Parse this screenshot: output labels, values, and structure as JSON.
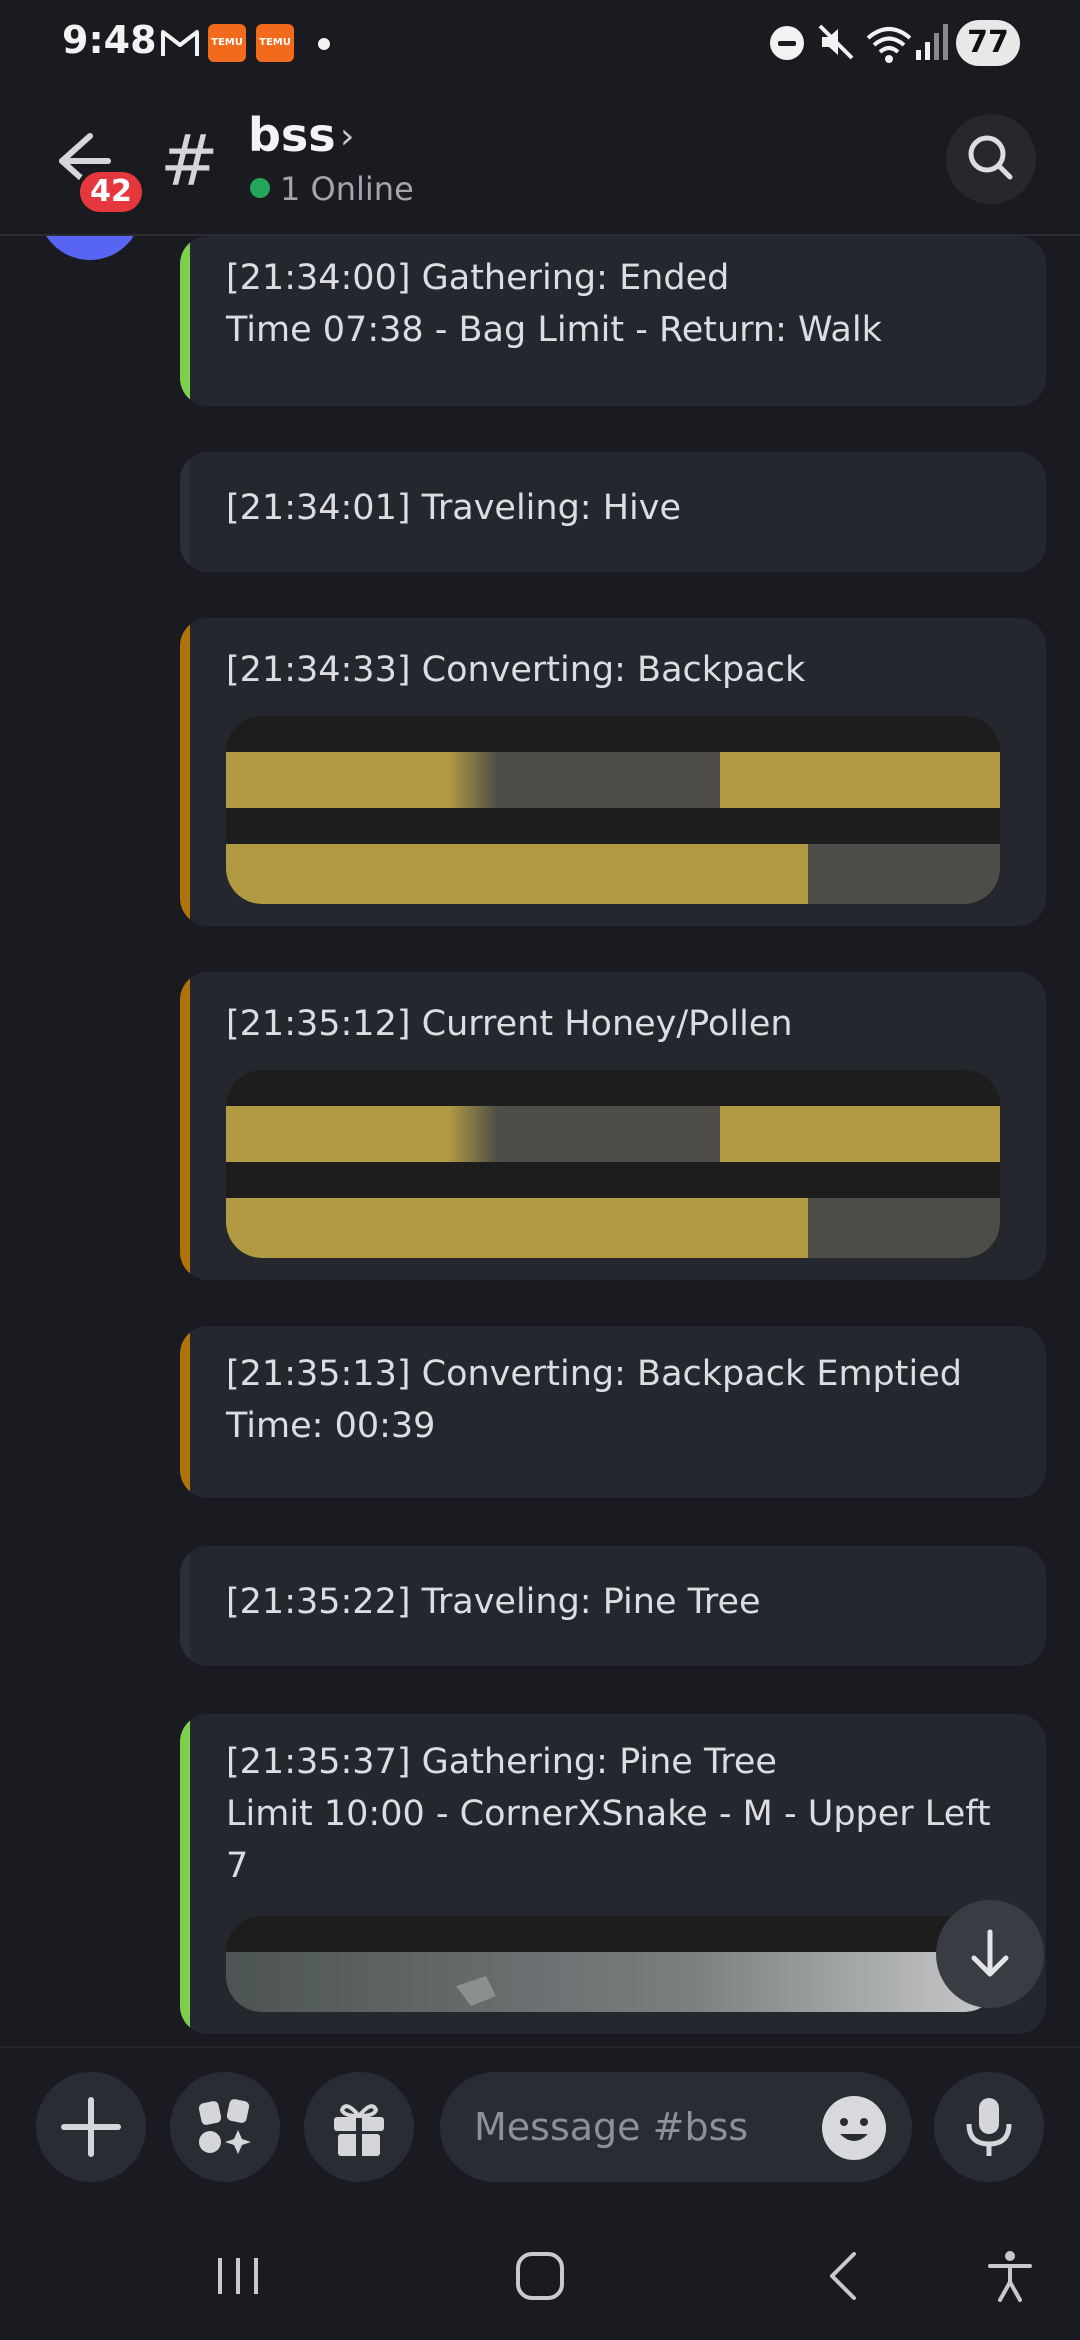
{
  "status_bar": {
    "time": "9:48",
    "temu_label": "TEMU",
    "battery": "77"
  },
  "header": {
    "unread_count": "42",
    "channel_name": "bss",
    "online_status": "1 Online"
  },
  "messages": [
    {
      "text": "[21:34:00] Gathering: Ended\nTime 07:38 - Bag Limit - Return: Walk",
      "accent": "#7fcf4f"
    },
    {
      "text": "[21:34:01] Traveling: Hive",
      "accent": "#2d2f36"
    },
    {
      "text": "[21:34:33] Converting: Backpack",
      "accent": "#b0720a",
      "has_image": true
    },
    {
      "text": "[21:35:12] Current Honey/Pollen",
      "accent": "#b0720a",
      "has_image": true
    },
    {
      "text": "[21:35:13] Converting: Backpack Emptied\nTime: 00:39",
      "accent": "#b0720a"
    },
    {
      "text": "[21:35:22] Traveling: Pine Tree",
      "accent": "#2d2f36"
    },
    {
      "text": "[21:35:37] Gathering: Pine Tree\nLimit 10:00 - CornerXSnake - M - Upper Left\n7",
      "accent": "#7fcf4f",
      "has_image": true
    }
  ],
  "composer": {
    "placeholder": "Message #bss"
  },
  "colors": {
    "background": "#1a1b20",
    "card": "#25272e",
    "gather_accent": "#7fcf4f",
    "convert_accent": "#b0720a",
    "online": "#23a55a",
    "badge": "#e5383e"
  }
}
